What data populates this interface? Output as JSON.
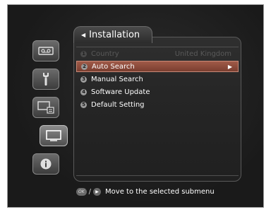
{
  "header": {
    "title": "Installation"
  },
  "sidebar": {
    "icons": [
      "tape-icon",
      "wrench-icon",
      "tv-settings-icon",
      "monitor-icon",
      "info-icon"
    ],
    "active_index": 3
  },
  "menu": {
    "items": [
      {
        "num": "1",
        "label": "Country",
        "value": "United Kingdom",
        "disabled": true
      },
      {
        "num": "2",
        "label": "Auto Search",
        "selected": true
      },
      {
        "num": "3",
        "label": "Manual Search"
      },
      {
        "num": "4",
        "label": "Software Update"
      },
      {
        "num": "5",
        "label": "Default Setting"
      }
    ]
  },
  "footer": {
    "key_ok": "OK",
    "separator": "/",
    "hint": "Move to the selected submenu"
  }
}
